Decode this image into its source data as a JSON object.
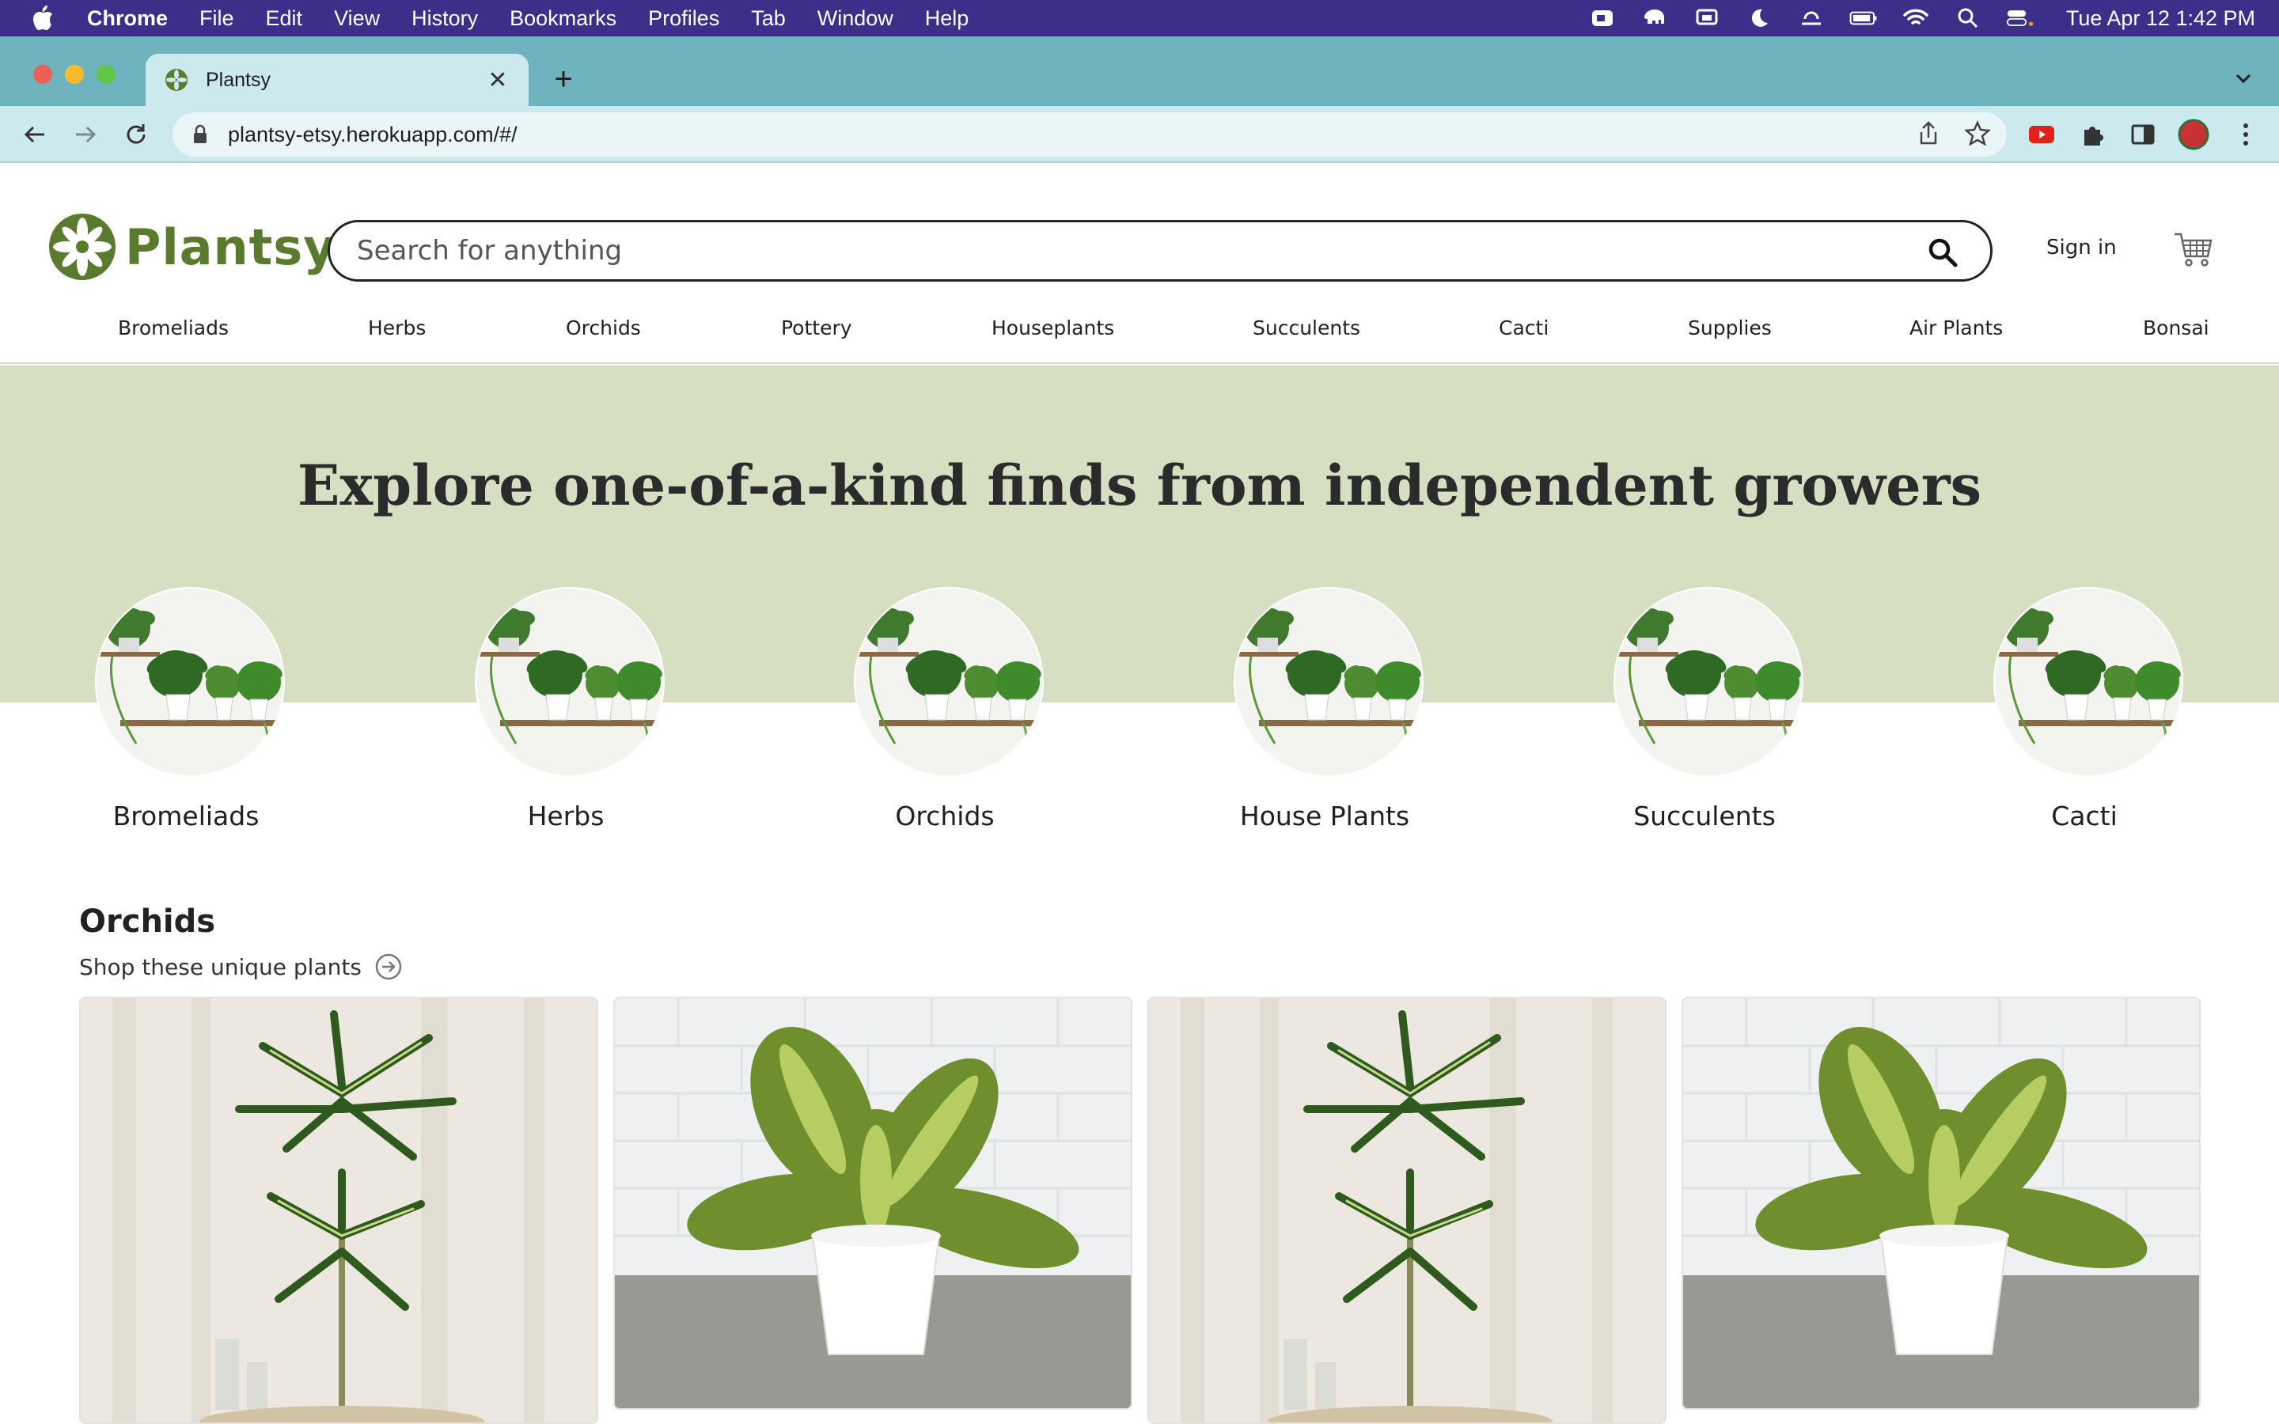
{
  "menubar": {
    "app": "Chrome",
    "items": [
      "File",
      "Edit",
      "View",
      "History",
      "Bookmarks",
      "Profiles",
      "Tab",
      "Window",
      "Help"
    ],
    "clock": "Tue Apr 12  1:42 PM"
  },
  "browser": {
    "tab_title": "Plantsy",
    "url": "plantsy-etsy.herokuapp.com/#/"
  },
  "header": {
    "logo_text": "Plantsy",
    "search_placeholder": "Search for anything",
    "signin": "Sign in",
    "categories": [
      "Bromeliads",
      "Herbs",
      "Orchids",
      "Pottery",
      "Houseplants",
      "Succulents",
      "Cacti",
      "Supplies",
      "Air Plants",
      "Bonsai"
    ]
  },
  "hero": {
    "title": "Explore one-of-a-kind finds from independent growers",
    "circles": [
      "Bromeliads",
      "Herbs",
      "Orchids",
      "House Plants",
      "Succulents",
      "Cacti"
    ]
  },
  "section": {
    "title": "Orchids",
    "link": "Shop these unique plants"
  },
  "colors": {
    "brand_green": "#5a7a2e",
    "hero_bg": "#d6dfc2",
    "tab_strip": "#6fb3be",
    "menubar": "#3b2f8a"
  }
}
